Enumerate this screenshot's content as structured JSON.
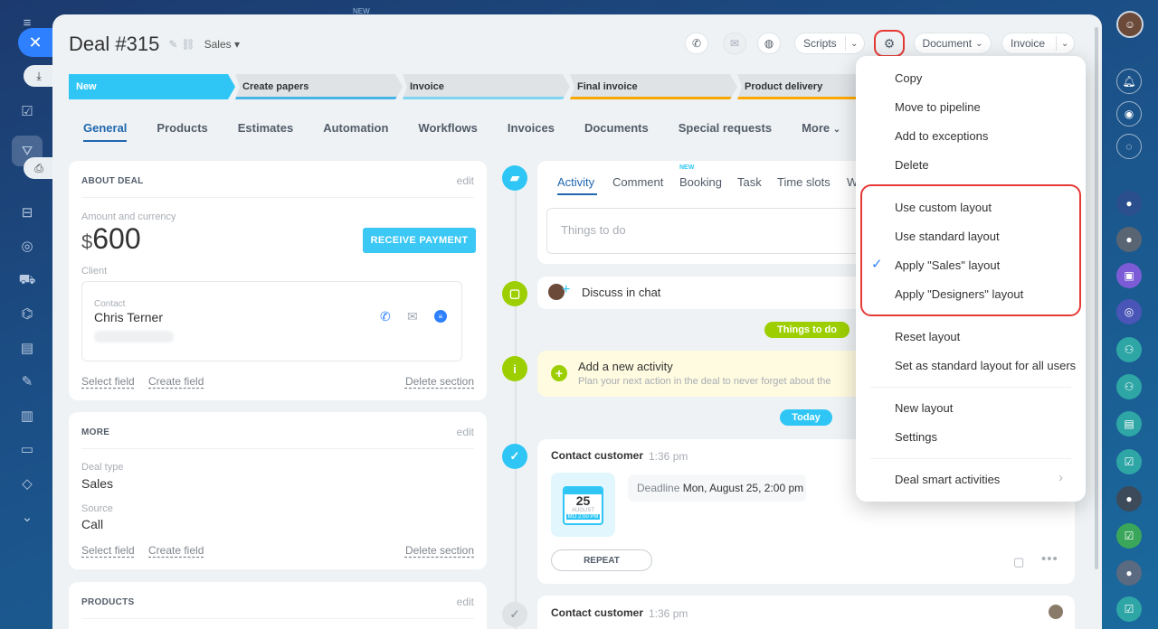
{
  "deal": {
    "title": "Deal #315",
    "pipeline": "Sales ▾"
  },
  "toolbar": {
    "scripts": "Scripts",
    "document": "Document",
    "invoice": "Invoice"
  },
  "stages": [
    {
      "label": "New",
      "color": "#2fc6f6"
    },
    {
      "label": "Create papers",
      "color": "#47b4e8"
    },
    {
      "label": "Invoice",
      "color": "#7fd6f2"
    },
    {
      "label": "Final invoice",
      "color": "#f7a700"
    },
    {
      "label": "Product delivery",
      "color": "#ffa900"
    }
  ],
  "tabs": [
    "General",
    "Products",
    "Estimates",
    "Automation",
    "Workflows",
    "Invoices",
    "Documents",
    "Special requests",
    "More"
  ],
  "about": {
    "header": "ABOUT DEAL",
    "edit": "edit",
    "amount_label": "Amount and currency",
    "currency": "$",
    "amount": "600",
    "pay_button": "RECEIVE PAYMENT",
    "client_label": "Client",
    "contact_label": "Contact",
    "contact_name": "Chris Terner",
    "select_field": "Select field",
    "create_field": "Create field",
    "delete_section": "Delete section"
  },
  "more": {
    "header": "MORE",
    "edit": "edit",
    "deal_type_label": "Deal type",
    "deal_type": "Sales",
    "source_label": "Source",
    "source": "Call",
    "select_field": "Select field",
    "create_field": "Create field",
    "delete_section": "Delete section"
  },
  "products": {
    "header": "PRODUCTS",
    "edit": "edit"
  },
  "activity": {
    "tabs": [
      "Activity",
      "Comment",
      "Booking",
      "Task",
      "Time slots",
      "W"
    ],
    "new_badge": "NEW",
    "placeholder": "Things to do",
    "discuss": "Discuss in chat",
    "things_to_do_pill": "Things to do",
    "add_title": "Add a new activity",
    "add_sub": "Plan your next action in the deal to never forget about the",
    "today_pill": "Today"
  },
  "timeline": [
    {
      "title": "Contact customer",
      "time": "1:36 pm",
      "cal_day": "25",
      "cal_month": "AUGUST",
      "cal_time": "MO 2:00 PM",
      "deadline_label": "Deadline",
      "deadline_value": "Mon, August 25, 2:00 pm",
      "repeat": "REPEAT"
    },
    {
      "title": "Contact customer",
      "time": "1:36 pm"
    }
  ],
  "menu": {
    "items_top": [
      "Copy",
      "Move to pipeline",
      "Add to exceptions",
      "Delete"
    ],
    "layout_items": [
      "Use custom layout",
      "Use standard layout",
      "Apply \"Sales\" layout",
      "Apply \"Designers\" layout"
    ],
    "checked_index": 2,
    "items_mid": [
      "Reset layout",
      "Set as standard layout for all users"
    ],
    "items_bottom": [
      "New layout",
      "Settings"
    ],
    "smart": "Deal smart activities"
  },
  "top_badge": "NEW",
  "colors": {
    "accent": "#2067b0",
    "highlight": "#e53935",
    "green": "#9dcf00",
    "blue": "#2fc6f6"
  }
}
